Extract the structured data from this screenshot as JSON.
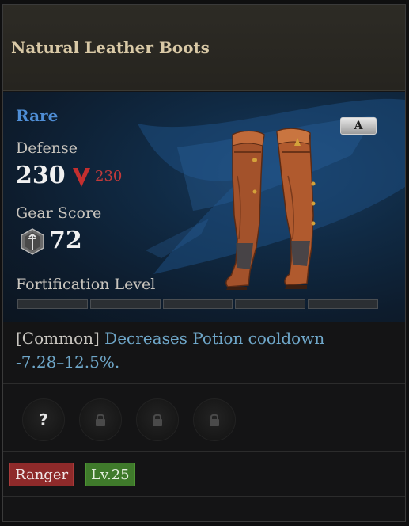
{
  "item": {
    "name": "Natural Leather Boots",
    "rarity": "Rare",
    "grade": "A",
    "rarity_color": "#4f8ed6"
  },
  "defense": {
    "label": "Defense",
    "value": "230",
    "compare_value": "230",
    "compare_icon": "down-chevron-icon",
    "compare_color": "#c43a3a"
  },
  "gear_score": {
    "label": "Gear Score",
    "value": "72",
    "icon": "gear-score-emblem-icon"
  },
  "fortification": {
    "label": "Fortification Level",
    "segments_total": 5,
    "segments_filled": 0
  },
  "effect": {
    "tier": "[Common]",
    "description": "Decreases Potion cooldown",
    "range": "-7.28–12.5%."
  },
  "sockets": [
    {
      "state": "unknown",
      "symbol": "?"
    },
    {
      "state": "locked",
      "icon": "lock-icon"
    },
    {
      "state": "locked",
      "icon": "lock-icon"
    },
    {
      "state": "locked",
      "icon": "lock-icon"
    }
  ],
  "tags": {
    "class": "Ranger",
    "level": "Lv.25"
  }
}
